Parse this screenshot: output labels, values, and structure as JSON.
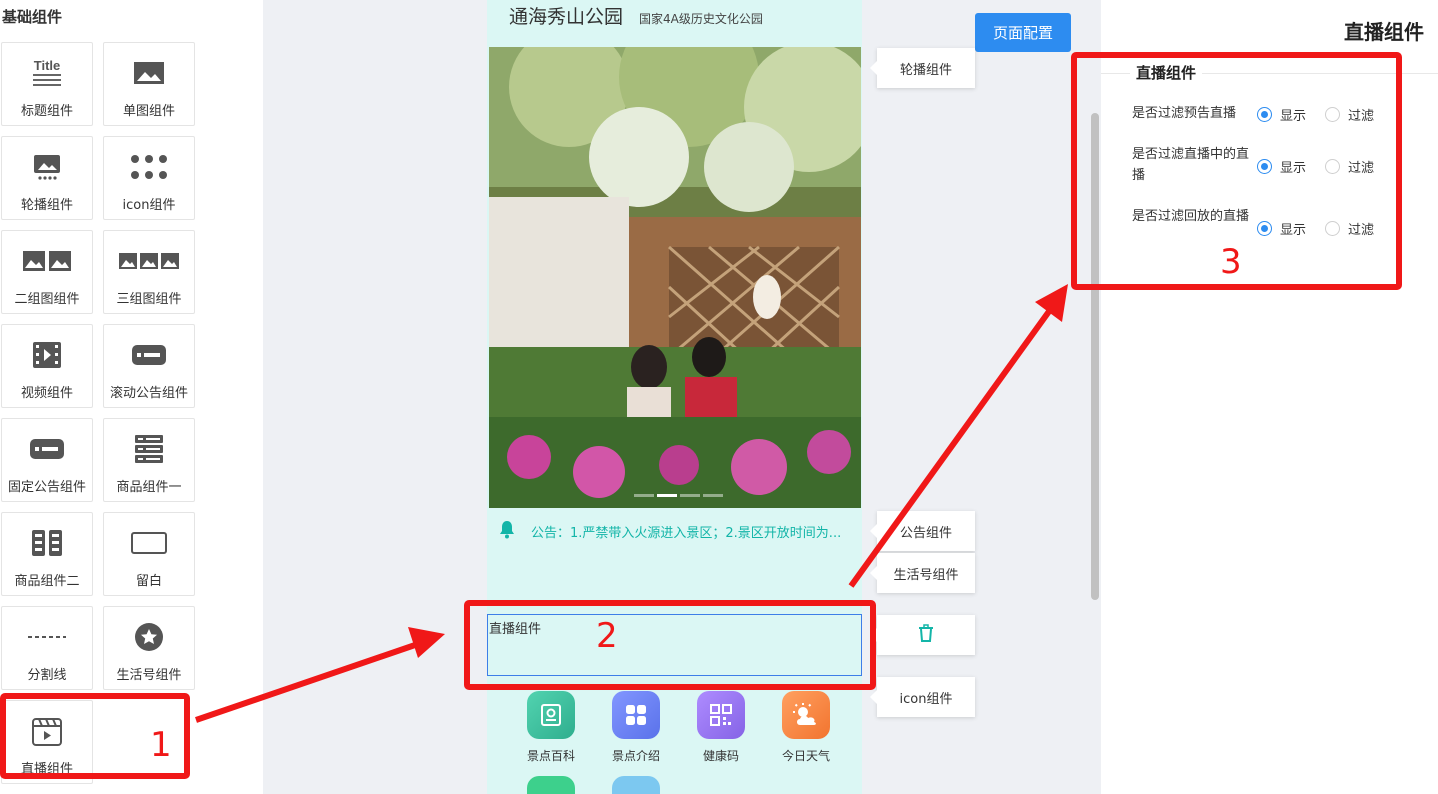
{
  "left_panel": {
    "title": "基础组件",
    "tiles": [
      {
        "label": "标题组件",
        "icon": "title-icon"
      },
      {
        "label": "单图组件",
        "icon": "single-image-icon"
      },
      {
        "label": "轮播组件",
        "icon": "carousel-icon"
      },
      {
        "label": "icon组件",
        "icon": "dots-grid-icon"
      },
      {
        "label": "二组图组件",
        "icon": "two-images-icon"
      },
      {
        "label": "三组图组件",
        "icon": "three-images-icon"
      },
      {
        "label": "视频组件",
        "icon": "film-icon"
      },
      {
        "label": "滚动公告组件",
        "icon": "scroll-notice-icon"
      },
      {
        "label": "固定公告组件",
        "icon": "fixed-notice-icon"
      },
      {
        "label": "商品组件一",
        "icon": "product-list-icon"
      },
      {
        "label": "商品组件二",
        "icon": "product-grid-icon"
      },
      {
        "label": "留白",
        "icon": "blank-rect-icon"
      },
      {
        "label": "分割线",
        "icon": "dashed-line-icon"
      },
      {
        "label": "生活号组件",
        "icon": "star-circle-icon"
      },
      {
        "label": "直播组件",
        "icon": "live-clapper-icon"
      }
    ]
  },
  "phone": {
    "title": "通海秀山公园",
    "subtitle": "国家4A级历史文化公园",
    "notice_text": "公告：1.严禁带入火源进入景区；2.景区开放时间为...",
    "live_box_label": "直播组件",
    "nav_items": [
      {
        "label": "景点百科",
        "icon": "encyclopedia-icon",
        "color": "#3fc5a2"
      },
      {
        "label": "景点介绍",
        "icon": "grid-apps-icon",
        "color": "#6e84f4"
      },
      {
        "label": "健康码",
        "icon": "qr-code-icon",
        "color": "#9b7cf0"
      },
      {
        "label": "今日天气",
        "icon": "weather-icon",
        "color": "#fb8a4a"
      }
    ]
  },
  "canvas": {
    "config_button": "页面配置",
    "tags": [
      "轮播组件",
      "公告组件",
      "生活号组件",
      "icon组件"
    ]
  },
  "right_panel": {
    "title": "直播组件",
    "section": "直播组件",
    "rows": [
      {
        "label": "是否过滤预告直播",
        "show": "显示",
        "filter": "过滤",
        "selected": "显示"
      },
      {
        "label": "是否过滤直播中的直播",
        "show": "显示",
        "filter": "过滤",
        "selected": "显示"
      },
      {
        "label": "是否过滤回放的直播",
        "show": "显示",
        "filter": "过滤",
        "selected": "显示"
      }
    ]
  },
  "annotations": {
    "one": "1",
    "two": "2",
    "three": "3"
  },
  "colors": {
    "accent": "#2d8cf0",
    "annotation": "#f01818",
    "phone_bg": "#dbf7f4",
    "notice": "#13b5a8"
  }
}
